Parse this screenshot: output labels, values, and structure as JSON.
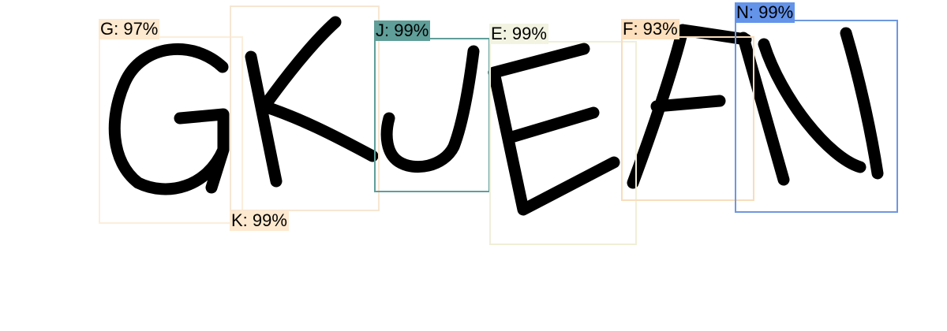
{
  "detections": [
    {
      "label": "G: 97%",
      "color": "#fde9cf",
      "box_color": "#fbeedc"
    },
    {
      "label": "K: 99%",
      "color": "#fde9cf",
      "box_color": "#f7e6d3"
    },
    {
      "label": "J: 99%",
      "color": "#5f9e99",
      "box_color": "#5f9e99"
    },
    {
      "label": "E: 99%",
      "color": "#f2f3e1",
      "box_color": "#efefd8"
    },
    {
      "label": "F: 93%",
      "color": "#fde0be",
      "box_color": "#f8ddbc"
    },
    {
      "label": "N: 99%",
      "color": "#6493ea",
      "box_color": "#6f97e0"
    }
  ]
}
